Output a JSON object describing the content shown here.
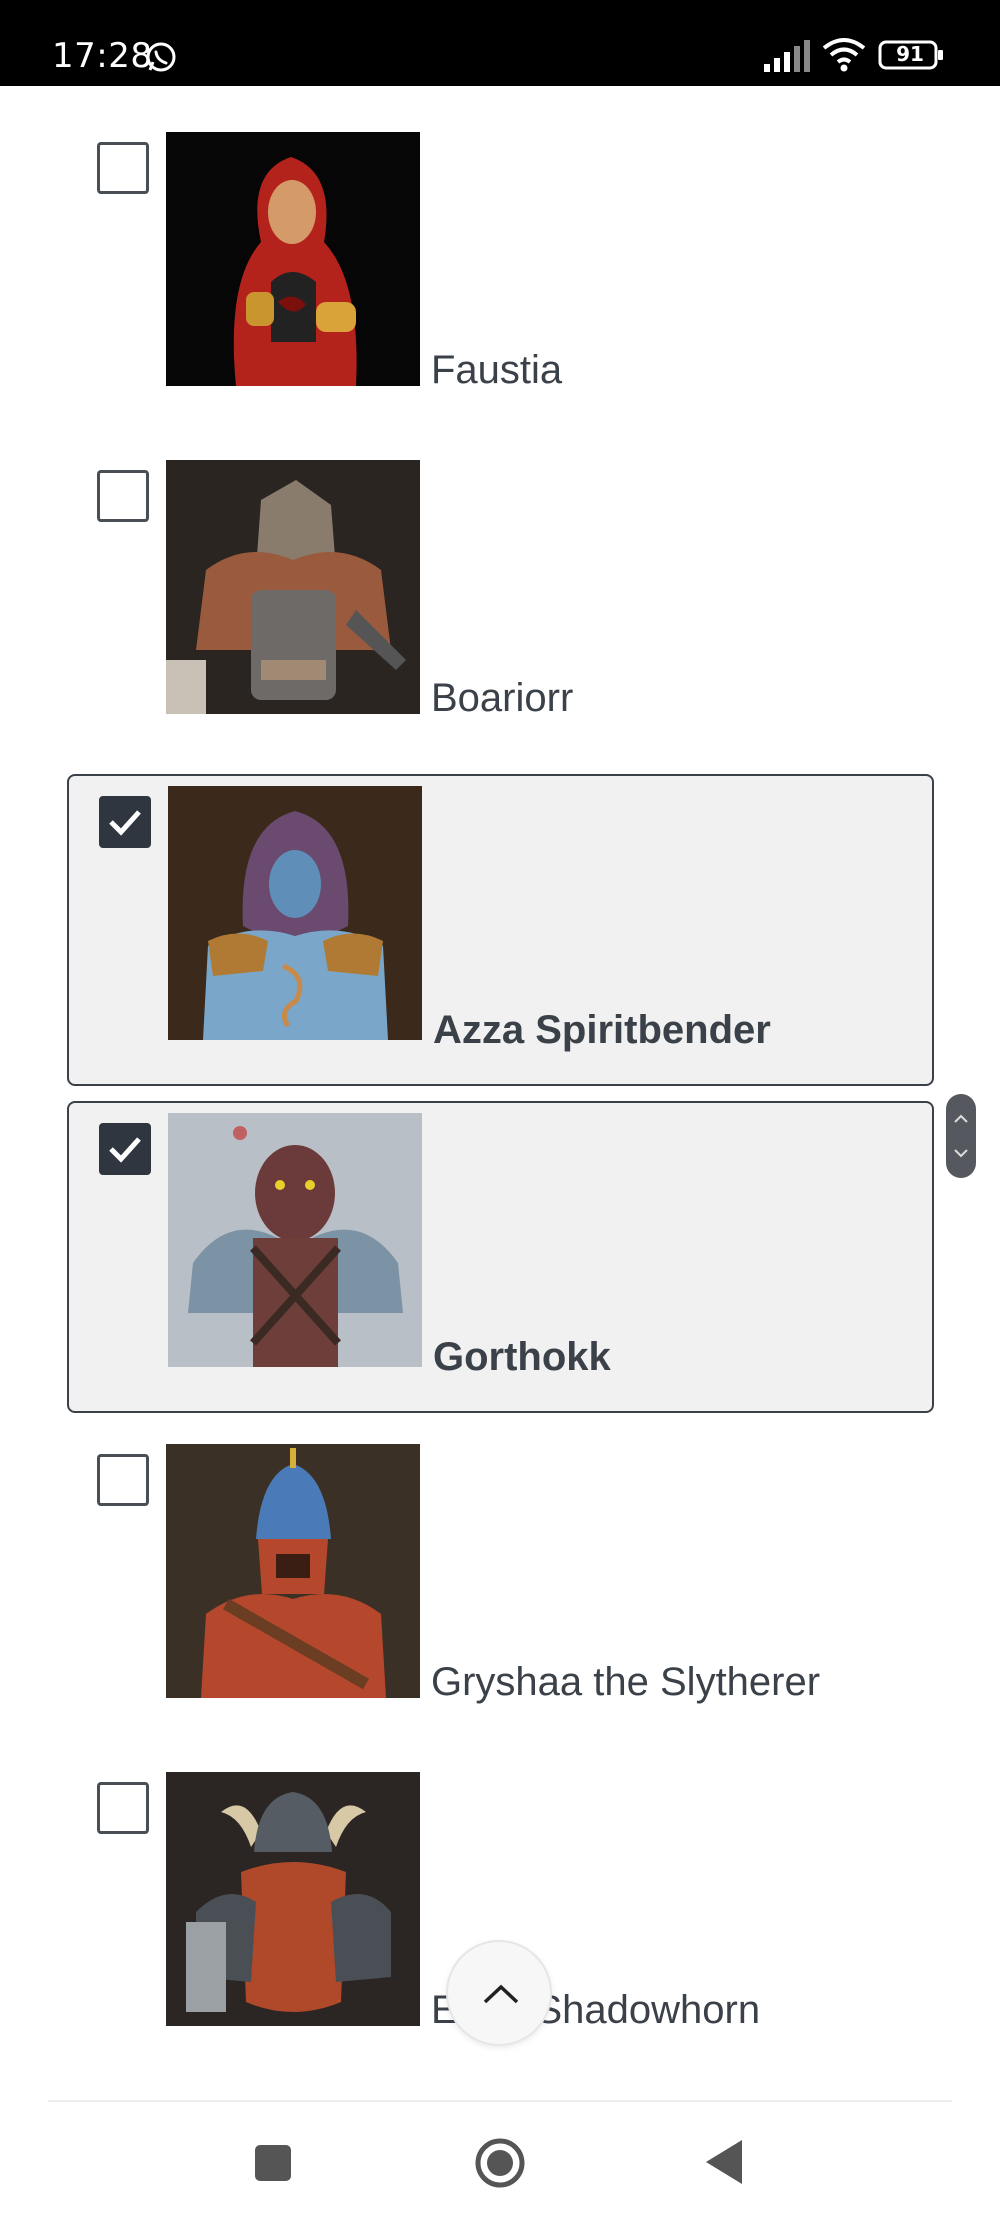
{
  "status_bar": {
    "time": "17:28",
    "battery": "91"
  },
  "items": [
    {
      "name": "Faustia",
      "checked": false
    },
    {
      "name": "Boariorr",
      "checked": false
    },
    {
      "name": "Azza Spiritbender",
      "checked": true
    },
    {
      "name": "Gorthokk",
      "checked": true
    },
    {
      "name": "Gryshaa the Slytherer",
      "checked": false
    },
    {
      "name": "Eldor Shadowhorn",
      "checked": false
    }
  ],
  "icons": {
    "status": [
      "whatsapp-icon",
      "signal-icon",
      "wifi-icon",
      "battery-icon"
    ],
    "nav": [
      "recent-apps-icon",
      "home-icon",
      "back-icon"
    ],
    "scroll_top": "chevron-up-icon"
  },
  "colors": {
    "accent": "#2f3640",
    "selected_bg": "#f1f1f1",
    "text": "#3b4149"
  }
}
